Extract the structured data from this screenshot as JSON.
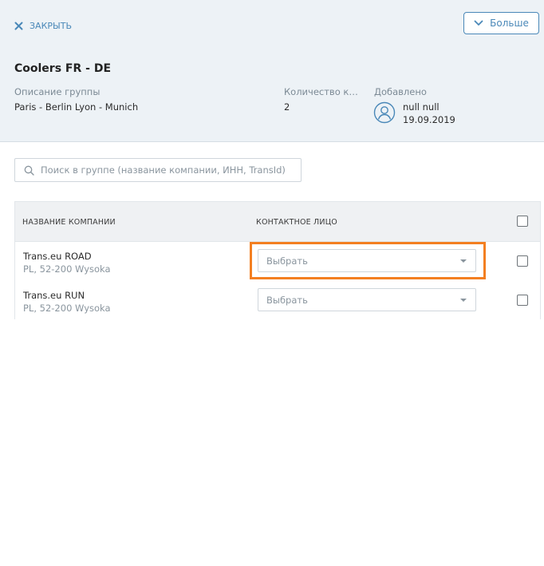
{
  "header": {
    "close_label": "ЗАКРЫТЬ",
    "more_label": "Больше",
    "group_title": "Coolers FR - DE",
    "description_label": "Описание группы",
    "description_value": "Paris - Berlin Lyon - Munich",
    "count_label": "Количество ко...",
    "count_value": "2",
    "added_label": "Добавлено",
    "added_user": "null null",
    "added_date": "19.09.2019"
  },
  "search": {
    "placeholder": "Поиск в группе (название компании, ИНН, TransId)",
    "value": ""
  },
  "table": {
    "headers": {
      "company": "НАЗВАНИЕ КОМПАНИИ",
      "contact": "КОНТАКТНОЕ ЛИЦО"
    },
    "rows": [
      {
        "name": "Trans.eu ROAD",
        "address": "PL, 52-200 Wysoka",
        "contact_placeholder": "Выбрать",
        "checked": false
      },
      {
        "name": "Trans.eu RUN",
        "address": "PL, 52-200 Wysoka",
        "contact_placeholder": "Выбрать",
        "checked": false
      }
    ]
  },
  "colors": {
    "accent": "#4a88b8",
    "header_bg": "#edf2f6",
    "highlight": "#f37f21"
  },
  "icons": {
    "close": "close-icon",
    "more": "chevron-down-icon",
    "search": "search-icon",
    "avatar": "user-avatar-icon",
    "select": "caret-down-icon"
  }
}
